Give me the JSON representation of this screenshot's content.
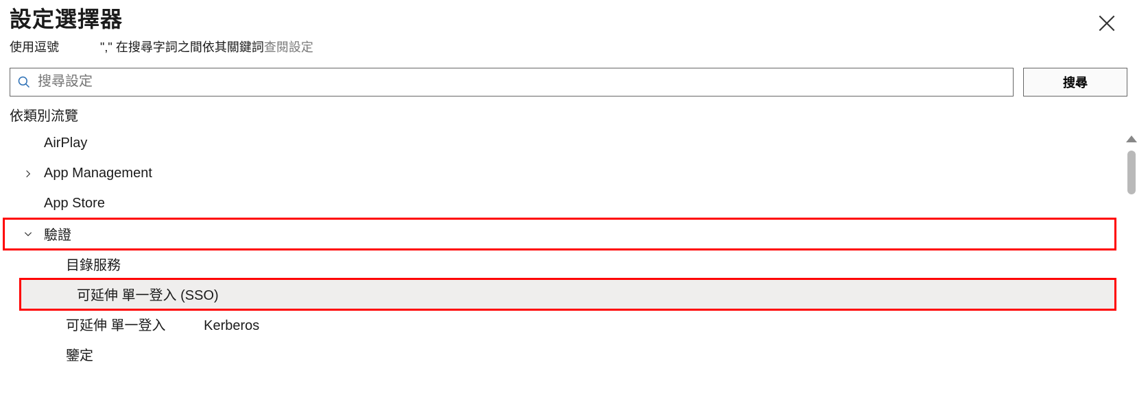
{
  "title": "設定選擇器",
  "subtitle_a": "使用逗號",
  "subtitle_quote": "\",\"",
  "subtitle_b": "在搜尋字詞之間依其關鍵詞",
  "subtitle_c": "查閱設定",
  "search": {
    "placeholder": "搜尋設定",
    "button": "搜尋"
  },
  "browse_label": "依類別流覽",
  "categories": {
    "airplay": "AirPlay",
    "app_mgmt": "App Management",
    "app_store": "App Store",
    "auth": "驗證",
    "auth_children": {
      "directory": "目錄服務",
      "ext_sso": "可延伸 單一登入 (SSO)",
      "ext_sso_kerb": "可延伸 單一登入          Kerberos",
      "identification": "鑒定"
    }
  }
}
